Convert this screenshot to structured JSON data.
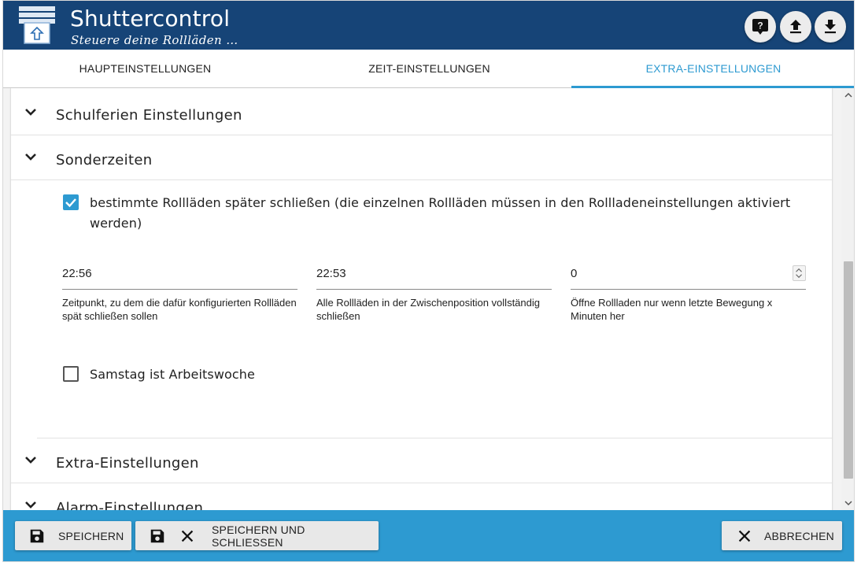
{
  "header": {
    "title": "Shuttercontrol",
    "subtitle": "Steuere deine Rollläden …",
    "buttons": [
      "help-icon",
      "upload-icon",
      "download-icon"
    ]
  },
  "tabs": [
    {
      "label": "HAUPTEINSTELLUNGEN",
      "active": false
    },
    {
      "label": "ZEIT-EINSTELLUNGEN",
      "active": false
    },
    {
      "label": "EXTRA-EINSTELLUNGEN",
      "active": true
    }
  ],
  "accordion": {
    "school_holidays": {
      "title": "Schulferien Einstellungen"
    },
    "special_times": {
      "title": "Sonderzeiten",
      "close_later": {
        "checked": true,
        "label": "bestimmte Rollläden später schließen (die einzelnen Rollläden müssen in den Rollladeneinstellungen aktiviert werden)"
      },
      "fields": [
        {
          "value": "22:56",
          "helper": "Zeitpunkt, zu dem die dafür konfigurierten Rollläden spät schließen sollen"
        },
        {
          "value": "22:53",
          "helper": "Alle Rollläden in der Zwischenposition vollständig schließen"
        },
        {
          "value": "0",
          "helper": "Öffne Rollladen nur wenn letzte Bewegung x Minuten her"
        }
      ],
      "saturday_workweek": {
        "checked": false,
        "label": "Samstag ist Arbeitswoche"
      }
    },
    "extra": {
      "title": "Extra-Einstellungen"
    },
    "alarm": {
      "title": "Alarm-Einstellungen"
    }
  },
  "footer": {
    "save_label": "SPEICHERN",
    "save_close_label": "SPEICHERN UND SCHLIESSEN",
    "cancel_label": "ABBRECHEN"
  },
  "colors": {
    "header_bg": "#164477",
    "accent": "#2d9ad1",
    "footer_bg": "#2d9ad1"
  }
}
